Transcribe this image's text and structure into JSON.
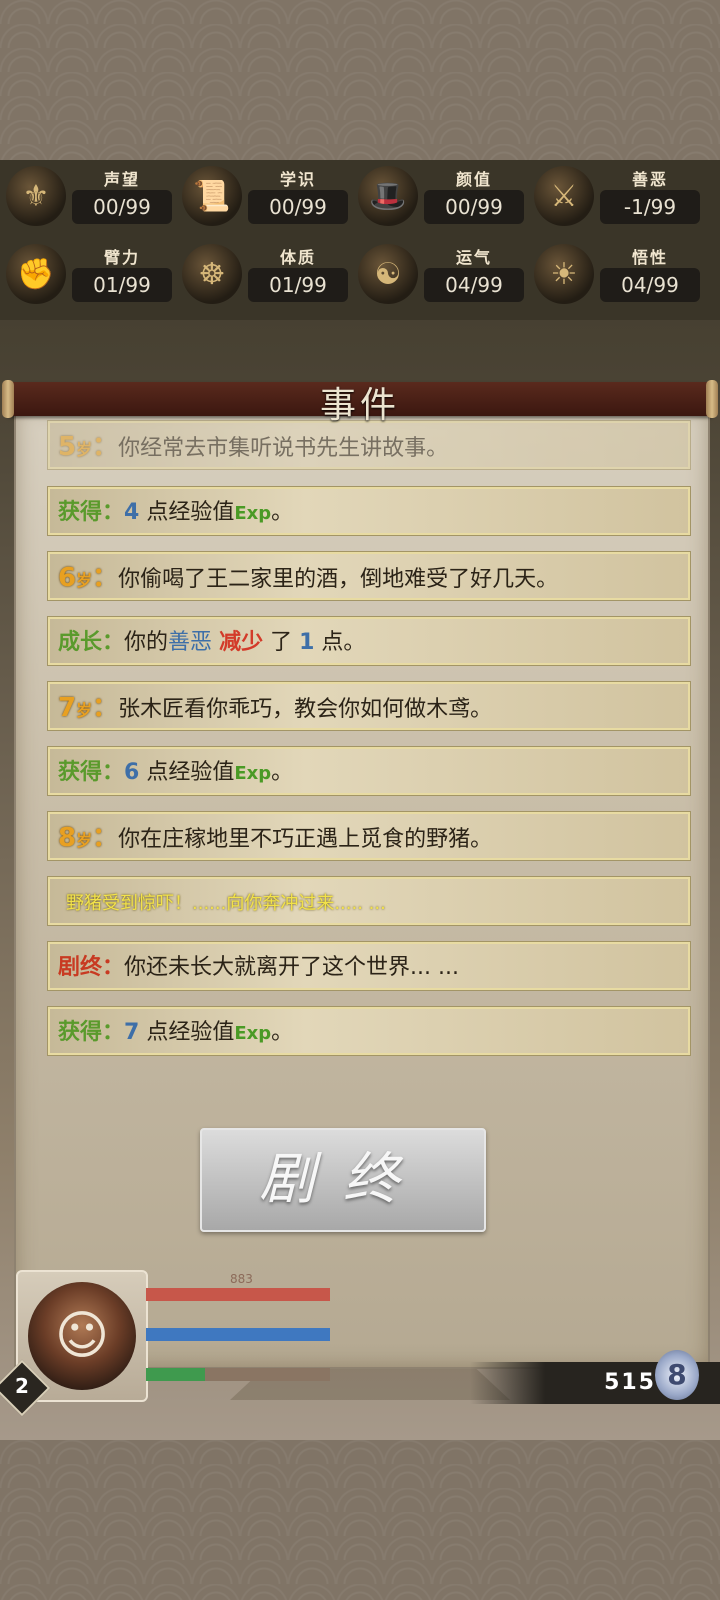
{
  "stats": [
    {
      "name": "声望",
      "value": "00/99",
      "icon": "prestige-icon",
      "glyph": "⚜"
    },
    {
      "name": "学识",
      "value": "00/99",
      "icon": "scroll-icon",
      "glyph": "📜"
    },
    {
      "name": "颜值",
      "value": "00/99",
      "icon": "hat-icon",
      "glyph": "🎩"
    },
    {
      "name": "善恶",
      "value": "-1/99",
      "icon": "crossed-swords-icon",
      "glyph": "⚔"
    },
    {
      "name": "臂力",
      "value": "01/99",
      "icon": "fist-icon",
      "glyph": "✊"
    },
    {
      "name": "体质",
      "value": "01/99",
      "icon": "body-icon",
      "glyph": "☸"
    },
    {
      "name": "运气",
      "value": "04/99",
      "icon": "coin-pouch-icon",
      "glyph": "☯"
    },
    {
      "name": "悟性",
      "value": "04/99",
      "icon": "mind-icon",
      "glyph": "☀"
    }
  ],
  "panel_title": "事件",
  "events": [
    {
      "age": "5",
      "age_unit": "岁",
      "sep": "：",
      "text": "你经常去市集听说书先生讲故事。"
    },
    {
      "prefix": "获得",
      "sep": "：",
      "num": "4",
      "text": " 点经验值",
      "exp": "Exp",
      "end": "。"
    },
    {
      "age": "6",
      "age_unit": "岁",
      "sep": "：",
      "text": "你偷喝了王二家里的酒，倒地难受了好几天。"
    },
    {
      "prefix": "成长",
      "sep": "：",
      "text": "你的",
      "trait": "善恶",
      "change": "减少",
      "text2": "了",
      "num": "1",
      "end": " 点。"
    },
    {
      "age": "7",
      "age_unit": "岁",
      "sep": "：",
      "text": "张木匠看你乖巧，教会你如何做木鸢。"
    },
    {
      "prefix": "获得",
      "sep": "：",
      "num": "6",
      "text": " 点经验值",
      "exp": "Exp",
      "end": "。"
    },
    {
      "age": "8",
      "age_unit": "岁",
      "sep": "：",
      "text": "你在庄稼地里不巧正遇上觅食的野猪。"
    },
    {
      "text": "野猪受到惊吓！......向你奔冲过来..... ..."
    },
    {
      "prefix": "剧终",
      "sep": "：",
      "text": "你还未长大就离开了这个世界... ..."
    },
    {
      "prefix": "获得",
      "sep": "：",
      "num": "7",
      "text": " 点经验值",
      "exp": "Exp",
      "end": "。"
    }
  ],
  "end_button": "剧终",
  "player": {
    "level": "2",
    "hp_ratio": 1.0,
    "mp_ratio": 1.0,
    "xp_ratio": 0.32,
    "hp_label": "883",
    "colors": {
      "hp": "#c7574a",
      "mp": "#3f78c0",
      "xp": "#3f9a4e"
    }
  },
  "coins": "515"
}
